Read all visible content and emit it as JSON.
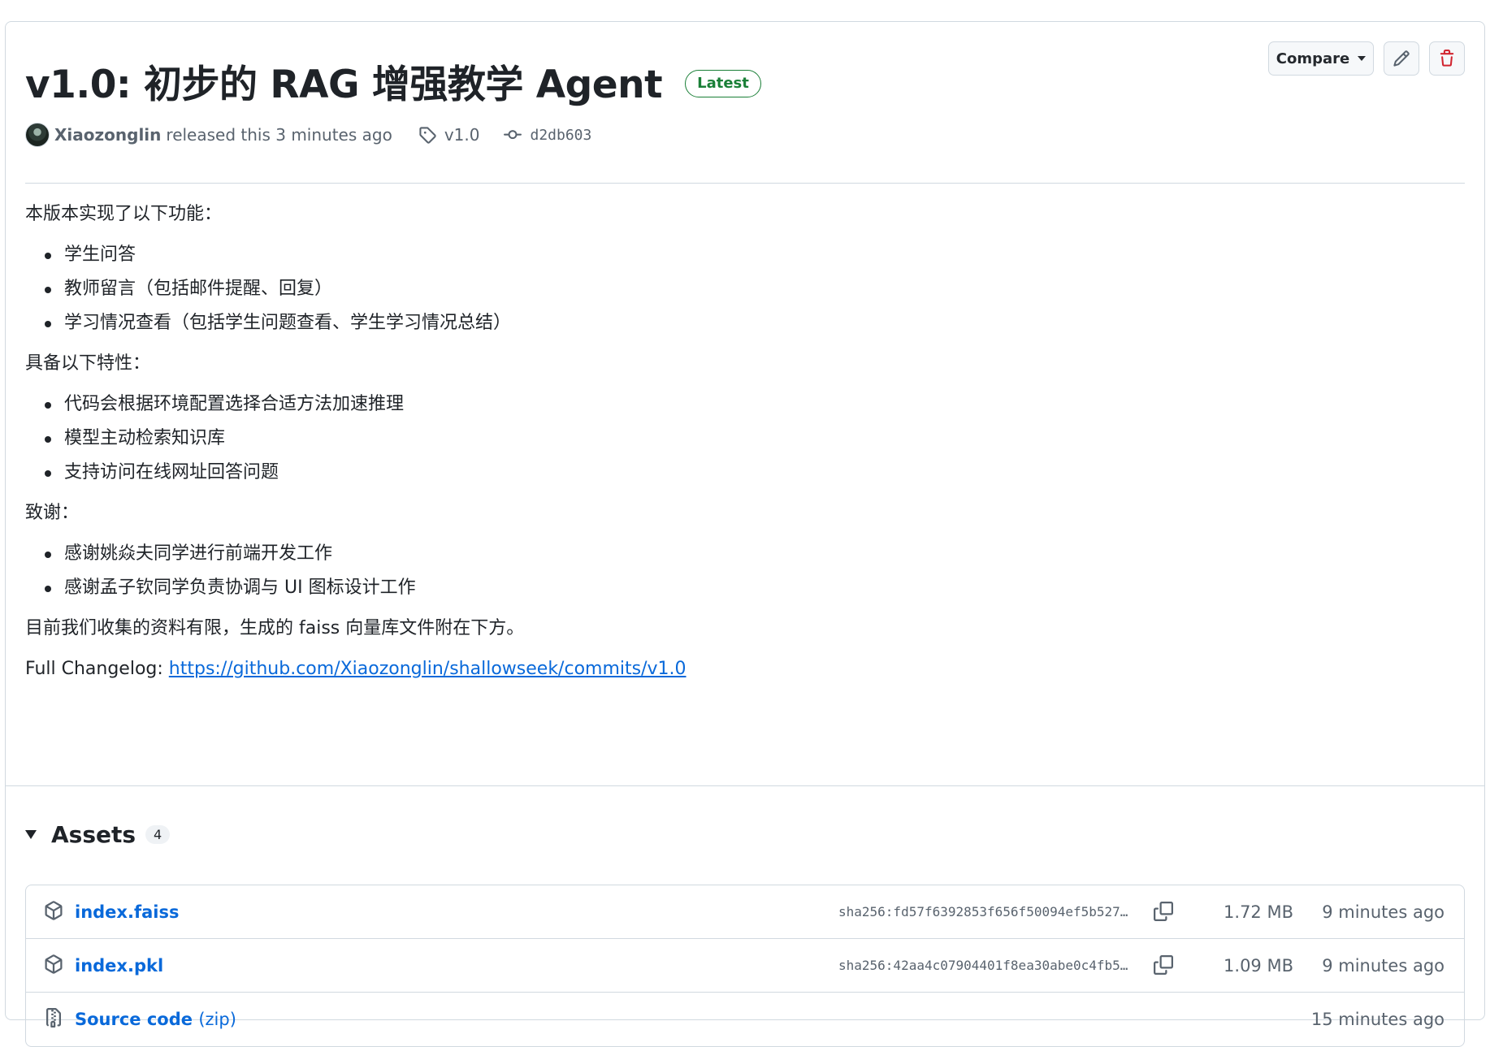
{
  "release": {
    "title": "v1.0: 初步的 RAG 增强教学 Agent",
    "badge": "Latest",
    "author": "Xiaozonglin",
    "released_text": "released this 3 minutes ago",
    "tag": "v1.0",
    "commit": "d2db603"
  },
  "actions": {
    "compare_label": "Compare"
  },
  "body": {
    "intro": "本版本实现了以下功能：",
    "features": [
      "学生问答",
      "教师留言（包括邮件提醒、回复）",
      "学习情况查看（包括学生问题查看、学生学习情况总结）"
    ],
    "traits_heading": "具备以下特性：",
    "traits": [
      "代码会根据环境配置选择合适方法加速推理",
      "模型主动检索知识库",
      "支持访问在线网址回答问题"
    ],
    "thanks_heading": "致谢：",
    "thanks": [
      "感谢姚焱夫同学进行前端开发工作",
      "感谢孟子钦同学负责协调与 UI 图标设计工作"
    ],
    "note": "目前我们收集的资料有限，生成的 faiss 向量库文件附在下方。",
    "changelog_label": "Full Changelog: ",
    "changelog_url": "https://github.com/Xiaozonglin/shallowseek/commits/v1.0"
  },
  "assets": {
    "title": "Assets",
    "count": "4",
    "items": [
      {
        "name": "index.faiss",
        "ext": "",
        "sha": "sha256:fd57f6392853f656f50094ef5b527…",
        "size": "1.72 MB",
        "ago": "9 minutes ago",
        "icon": "package-icon"
      },
      {
        "name": "index.pkl",
        "ext": "",
        "sha": "sha256:42aa4c07904401f8ea30abe0c4fb5…",
        "size": "1.09 MB",
        "ago": "9 minutes ago",
        "icon": "package-icon"
      },
      {
        "name": "Source code",
        "ext": "(zip)",
        "sha": "",
        "size": "",
        "ago": "15 minutes ago",
        "icon": "file-zip-icon"
      }
    ]
  },
  "colors": {
    "accent": "#0969da",
    "success": "#1a7f37",
    "danger": "#d1242f"
  }
}
